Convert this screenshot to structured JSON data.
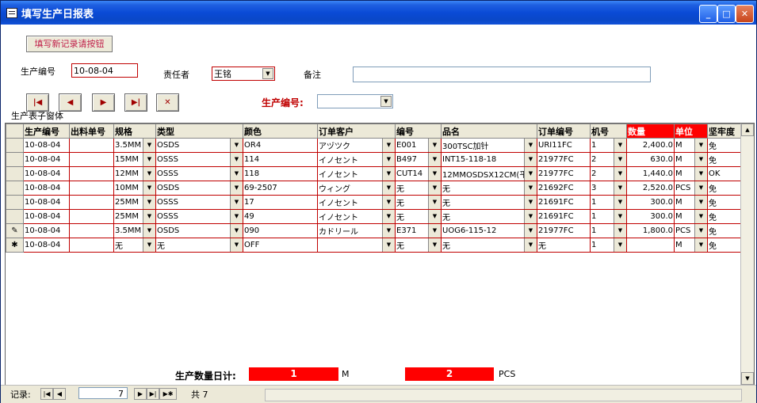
{
  "window": {
    "title": "填写生产日报表",
    "icons": {
      "app": "form-icon",
      "minimize": "minimize-icon",
      "maximize": "maximize-icon",
      "close": "close-icon"
    }
  },
  "form": {
    "new_record_button": "填写新记录请按钮",
    "production_no_label": "生产编号",
    "production_no_value": "10-08-04",
    "responsible_label": "责任者",
    "responsible_value": "王铭",
    "remarks_label": "备注",
    "remarks_value": "",
    "lookup_label": "生产编号:",
    "lookup_value": "",
    "subform_caption": "生产表子窗体",
    "nav_icons": [
      "first-record-icon",
      "prev-record-icon",
      "next-record-icon",
      "last-record-icon",
      "delete-record-icon"
    ],
    "nav_glyphs": [
      "|◀",
      "◀",
      "▶",
      "▶|",
      "✕"
    ]
  },
  "grid": {
    "columns": [
      "生产编号",
      "出料单号",
      "规格",
      "类型",
      "颜色",
      "订单客户",
      "编号",
      "品名",
      "订单编号",
      "机号",
      "数量",
      "单位",
      "坚牢度"
    ],
    "rows": [
      {
        "sel": "",
        "cells": [
          "10-08-04",
          "",
          "3.5MM",
          "OSDS",
          "OR4",
          "アヅツク",
          "E001",
          "300TSC加针",
          "URI11FC",
          "1",
          "2,400.0",
          "M",
          "免"
        ]
      },
      {
        "sel": "",
        "cells": [
          "10-08-04",
          "",
          "15MM",
          "OSSS",
          "114",
          "イノセント",
          "B497",
          "INT15-118-18",
          "21977FC",
          "2",
          "630.0",
          "M",
          "免"
        ]
      },
      {
        "sel": "",
        "cells": [
          "10-08-04",
          "",
          "12MM",
          "OSSS",
          "118",
          "イノセント",
          "CUT14",
          "12MMOSDSX12CM(平)",
          "21977FC",
          "2",
          "1,440.0",
          "M",
          "OK"
        ]
      },
      {
        "sel": "",
        "cells": [
          "10-08-04",
          "",
          "10MM",
          "OSDS",
          "69-2507",
          "ウィング",
          "无",
          "无",
          "21692FC",
          "3",
          "2,520.0",
          "PCS",
          "免"
        ]
      },
      {
        "sel": "",
        "cells": [
          "10-08-04",
          "",
          "25MM",
          "OSSS",
          "17",
          "イノセント",
          "无",
          "无",
          "21691FC",
          "1",
          "300.0",
          "M",
          "免"
        ]
      },
      {
        "sel": "",
        "cells": [
          "10-08-04",
          "",
          "25MM",
          "OSSS",
          "49",
          "イノセント",
          "无",
          "无",
          "21691FC",
          "1",
          "300.0",
          "M",
          "免"
        ]
      },
      {
        "sel": "✎",
        "cells": [
          "10-08-04",
          "",
          "3.5MM",
          "OSDS",
          "090",
          "カドリール",
          "E371",
          "UOG6-115-12",
          "21977FC",
          "1",
          "1,800.0",
          "PCS",
          "免"
        ]
      },
      {
        "sel": "✱",
        "cells": [
          "10-08-04",
          "",
          "无",
          "无",
          "OFF",
          "",
          "无",
          "无",
          "无",
          "1",
          "",
          "M",
          "免"
        ]
      }
    ]
  },
  "summary": {
    "label": "生产数量日计:",
    "m_value": "1",
    "m_unit": "M",
    "pcs_value": "2",
    "pcs_unit": "PCS"
  },
  "statusbar": {
    "record_label": "记录:",
    "current_record": "7",
    "total_label": "共 7"
  },
  "colors": {
    "accent_red": "#ff0000",
    "border_red": "#c00000",
    "title_blue": "#0a4ad6"
  }
}
